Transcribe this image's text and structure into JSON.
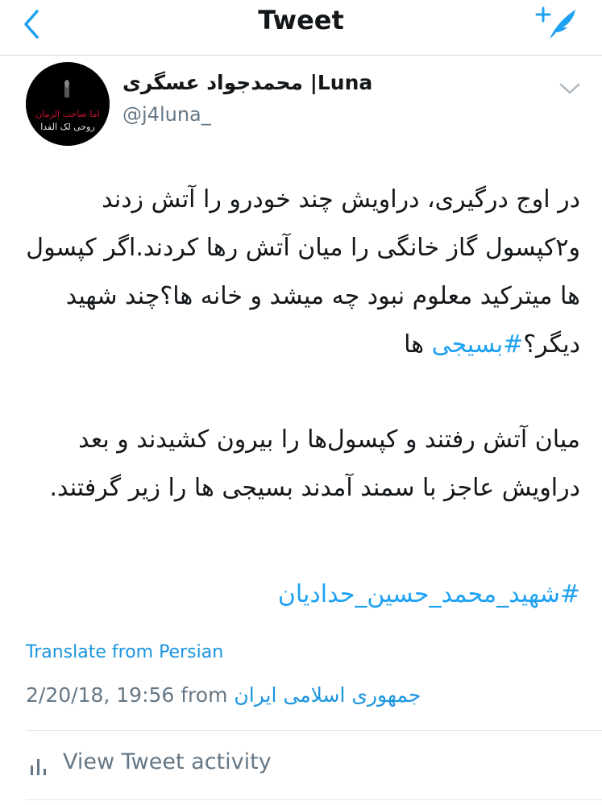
{
  "header": {
    "title": "Tweet",
    "back_icon": "chevron-left-icon",
    "compose_icon": "compose-tweet-icon"
  },
  "author": {
    "display_name": "محمدجواد عسگری |Luna",
    "handle": "@j4luna_",
    "avatar_text_line1": "اما صاحب الزمان",
    "avatar_text_line2": "روحی لک الفدا"
  },
  "tweet": {
    "paragraph1": "در اوج درگیری، دراویش چند خودرو را آتش زدند و۲کپسول گاز خانگی را میان آتش رها کردند.اگر کپسول ها میترکید معلوم نبود چه میشد و خانه ها؟چند شهید دیگر؟",
    "paragraph1_hashtag": "#بسیجی",
    "paragraph1_tail": " ها",
    "paragraph2": "میان آتش رفتند و کپسول‌ها را بیرون کشیدند و بعد دراویش عاجز با سمند آمدند بسیجی ها را زیر گرفتند.",
    "hashtag2": "#شهید_محمد_حسین_حدادیان"
  },
  "translate_label": "Translate from Persian",
  "meta": {
    "timestamp": "2/20/18, 19:56 from",
    "source": "جمهوری اسلامی ایران"
  },
  "activity_label": "View Tweet activity",
  "colors": {
    "accent": "#1da1f2",
    "secondary_text": "#657786",
    "divider": "#e1e8ed"
  }
}
